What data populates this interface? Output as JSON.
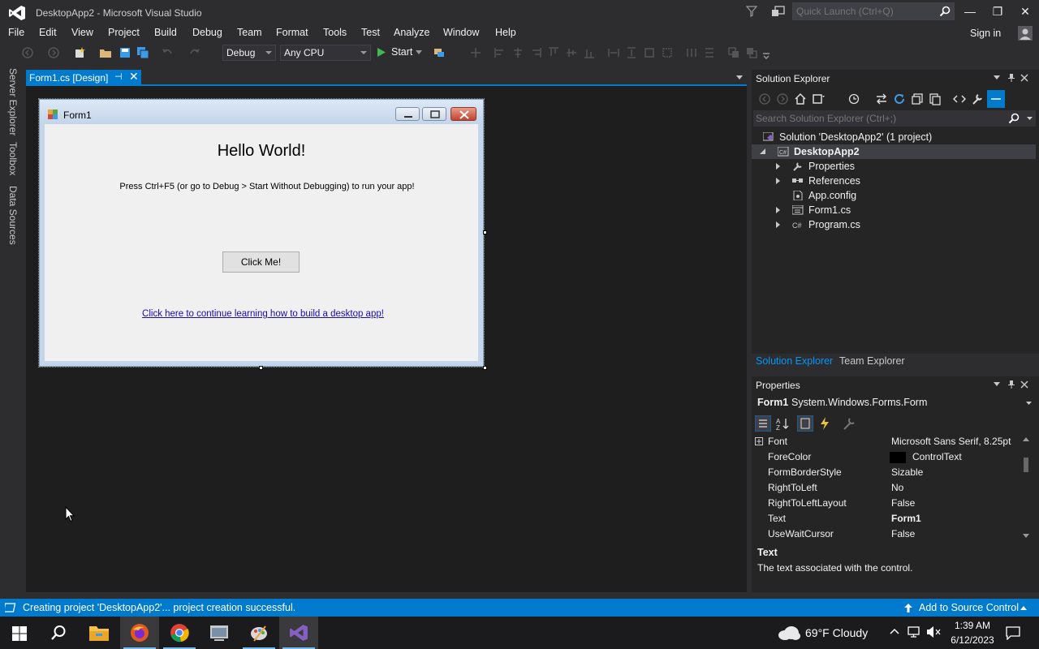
{
  "window": {
    "title": "DesktopApp2 - Microsoft Visual Studio",
    "quick_launch_placeholder": "Quick Launch (Ctrl+Q)",
    "minimize": "—",
    "restore": "❐",
    "close": "✕"
  },
  "menu": {
    "items": [
      "File",
      "Edit",
      "View",
      "Project",
      "Build",
      "Debug",
      "Team",
      "Format",
      "Tools",
      "Test",
      "Analyze",
      "Window",
      "Help"
    ],
    "sign_in": "Sign in"
  },
  "toolbar": {
    "config": "Debug",
    "platform": "Any CPU",
    "start_label": "Start"
  },
  "side_tabs": [
    "Server Explorer",
    "Toolbox",
    "Data Sources"
  ],
  "document_tab": {
    "label": "Form1.cs [Design]",
    "pin": "⊣",
    "close": "✕"
  },
  "designer_form": {
    "title": "Form1",
    "heading": "Hello World!",
    "instructions": "Press Ctrl+F5 (or go to Debug > Start Without Debugging) to run your app!",
    "button_label": "Click Me!",
    "link_text": "Click here to continue learning how to build a desktop app!"
  },
  "solution_explorer": {
    "title": "Solution Explorer",
    "search_placeholder": "Search Solution Explorer (Ctrl+;)",
    "tree": {
      "solution": "Solution 'DesktopApp2' (1 project)",
      "project": "DesktopApp2",
      "items": [
        "Properties",
        "References",
        "App.config",
        "Form1.cs",
        "Program.cs"
      ]
    },
    "tabs": [
      "Solution Explorer",
      "Team Explorer"
    ]
  },
  "properties": {
    "title": "Properties",
    "object_name": "Form1",
    "object_type": "System.Windows.Forms.Form",
    "rows": [
      {
        "name": "Font",
        "value": "Microsoft Sans Serif, 8.25pt"
      },
      {
        "name": "ForeColor",
        "value": "ControlText"
      },
      {
        "name": "FormBorderStyle",
        "value": "Sizable"
      },
      {
        "name": "RightToLeft",
        "value": "No"
      },
      {
        "name": "RightToLeftLayout",
        "value": "False"
      },
      {
        "name": "Text",
        "value": "Form1"
      },
      {
        "name": "UseWaitCursor",
        "value": "False"
      }
    ],
    "description_title": "Text",
    "description": "The text associated with the control."
  },
  "status_bar": {
    "message": "Creating project 'DesktopApp2'... project creation successful.",
    "source_control": "Add to Source Control"
  },
  "taskbar": {
    "weather": "69°F  Cloudy",
    "time": "1:39 AM",
    "date": "6/12/2023"
  },
  "colors": {
    "accent": "#007acc",
    "link_blue": "#0097fb",
    "background": "#2d2d30",
    "editor": "#1e1e1e",
    "vs_purple": "#865fc5"
  }
}
